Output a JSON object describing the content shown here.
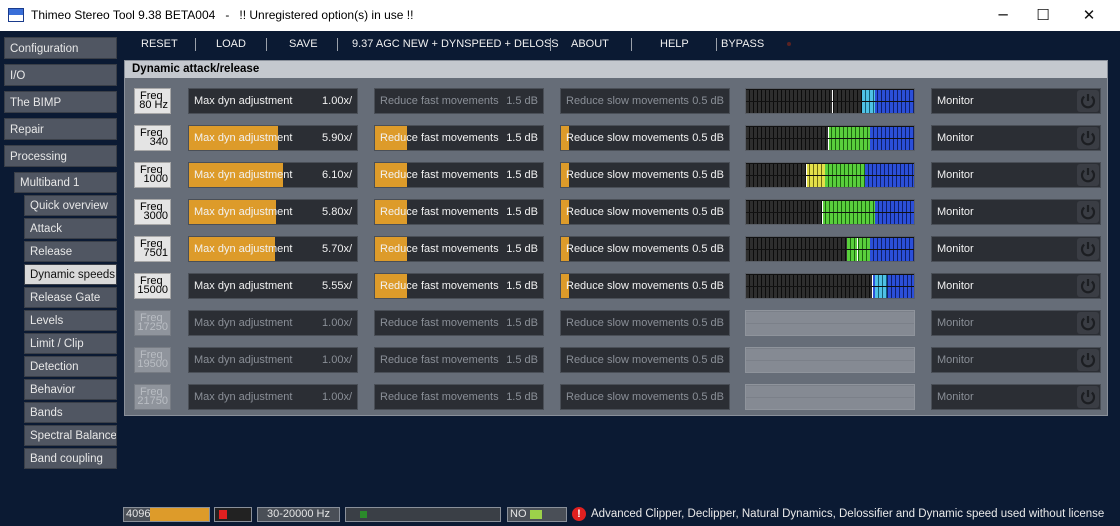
{
  "window": {
    "app_title": "Thimeo Stereo Tool 9.38 BETA004",
    "separator": "-",
    "warning": "!! Unregistered option(s) in use !!",
    "minimize_glyph": "─",
    "maximize_glyph": "☐",
    "close_glyph": "✕"
  },
  "sidebar": {
    "items": [
      {
        "label": "Configuration",
        "level": 0,
        "selected": false
      },
      {
        "label": "I/O",
        "level": 0,
        "selected": false
      },
      {
        "label": "The BIMP",
        "level": 0,
        "selected": false
      },
      {
        "label": "Repair",
        "level": 0,
        "selected": false
      },
      {
        "label": "Processing",
        "level": 0,
        "selected": false
      },
      {
        "label": "Multiband 1",
        "level": 1,
        "selected": false
      },
      {
        "label": "Quick overview",
        "level": 2,
        "selected": false
      },
      {
        "label": "Attack",
        "level": 2,
        "selected": false
      },
      {
        "label": "Release",
        "level": 2,
        "selected": false
      },
      {
        "label": "Dynamic speeds",
        "level": 2,
        "selected": true
      },
      {
        "label": "Release Gate",
        "level": 2,
        "selected": false
      },
      {
        "label": "Levels",
        "level": 2,
        "selected": false
      },
      {
        "label": "Limit / Clip",
        "level": 2,
        "selected": false
      },
      {
        "label": "Detection",
        "level": 2,
        "selected": false
      },
      {
        "label": "Behavior",
        "level": 2,
        "selected": false
      },
      {
        "label": "Bands",
        "level": 2,
        "selected": false
      },
      {
        "label": "Spectral Balance",
        "level": 2,
        "selected": false
      },
      {
        "label": "Band coupling",
        "level": 2,
        "selected": false
      }
    ]
  },
  "toolbar": {
    "reset": "RESET",
    "load": "LOAD",
    "save": "SAVE",
    "preset": "9.37 AGC NEW + DYNSPEED + DELOSS",
    "about": "ABOUT",
    "help": "HELP",
    "bypass": "BYPASS"
  },
  "panel": {
    "title": "Dynamic attack/release",
    "freq_label": "Freq",
    "max_dyn_label": "Max dyn adjustment",
    "fast_label": "Reduce fast movements",
    "slow_label": "Reduce slow movements",
    "monitor_label": "Monitor",
    "bands": [
      {
        "freq": "80 Hz",
        "enabled": true,
        "max_dyn": "1.00x/",
        "max_dyn_fill": 0.0,
        "fast": "1.5 dB",
        "fast_fill": 0.0,
        "slow": "0.5 dB",
        "slow_fill": 0.0,
        "meter": [
          {
            "type": "blue",
            "from": 0.69,
            "to": 1.0
          },
          {
            "type": "cyan",
            "from": 0.69,
            "to": 0.77
          }
        ],
        "meter_peak": 0.51
      },
      {
        "freq": "340",
        "enabled": true,
        "max_dyn": "5.90x/",
        "max_dyn_fill": 0.53,
        "fast": "1.5 dB",
        "fast_fill": 0.19,
        "slow": "0.5 dB",
        "slow_fill": 0.05,
        "meter": [
          {
            "type": "green",
            "from": 0.49,
            "to": 0.74
          },
          {
            "type": "blue",
            "from": 0.74,
            "to": 1.0
          }
        ],
        "meter_peak": 0.49
      },
      {
        "freq": "1000",
        "enabled": true,
        "max_dyn": "6.10x/",
        "max_dyn_fill": 0.56,
        "fast": "1.5 dB",
        "fast_fill": 0.19,
        "slow": "0.5 dB",
        "slow_fill": 0.05,
        "meter": [
          {
            "type": "yellow",
            "from": 0.36,
            "to": 0.47
          },
          {
            "type": "green",
            "from": 0.47,
            "to": 0.71
          },
          {
            "type": "blue",
            "from": 0.71,
            "to": 1.0
          }
        ],
        "meter_peak": 0.36
      },
      {
        "freq": "3000",
        "enabled": true,
        "max_dyn": "5.80x/",
        "max_dyn_fill": 0.52,
        "fast": "1.5 dB",
        "fast_fill": 0.19,
        "slow": "0.5 dB",
        "slow_fill": 0.05,
        "meter": [
          {
            "type": "green",
            "from": 0.45,
            "to": 0.77
          },
          {
            "type": "blue",
            "from": 0.77,
            "to": 1.0
          }
        ],
        "meter_peak": 0.45
      },
      {
        "freq": "7501",
        "enabled": true,
        "max_dyn": "5.70x/",
        "max_dyn_fill": 0.51,
        "fast": "1.5 dB",
        "fast_fill": 0.19,
        "slow": "0.5 dB",
        "slow_fill": 0.05,
        "meter": [
          {
            "type": "green",
            "from": 0.6,
            "to": 0.74
          },
          {
            "type": "blue",
            "from": 0.74,
            "to": 1.0
          }
        ],
        "meter_peak": 0.66
      },
      {
        "freq": "15000",
        "enabled": true,
        "max_dyn": "5.55x/",
        "max_dyn_fill": 0.0,
        "fast": "1.5 dB",
        "fast_fill": 0.19,
        "slow": "0.5 dB",
        "slow_fill": 0.05,
        "meter": [
          {
            "type": "blue",
            "from": 0.75,
            "to": 1.0
          },
          {
            "type": "cyan",
            "from": 0.77,
            "to": 0.84
          }
        ],
        "meter_peak": 0.75
      },
      {
        "freq": "17250",
        "enabled": false,
        "max_dyn": "1.00x/",
        "max_dyn_fill": 0.0,
        "fast": "1.5 dB",
        "fast_fill": 0.0,
        "slow": "0.5 dB",
        "slow_fill": 0.0,
        "meter": [],
        "meter_peak": null
      },
      {
        "freq": "19500",
        "enabled": false,
        "max_dyn": "1.00x/",
        "max_dyn_fill": 0.0,
        "fast": "1.5 dB",
        "fast_fill": 0.0,
        "slow": "0.5 dB",
        "slow_fill": 0.0,
        "meter": [],
        "meter_peak": null
      },
      {
        "freq": "21750",
        "enabled": false,
        "max_dyn": "1.00x/",
        "max_dyn_fill": 0.0,
        "fast": "1.5 dB",
        "fast_fill": 0.0,
        "slow": "0.5 dB",
        "slow_fill": 0.0,
        "meter": [],
        "meter_peak": null
      }
    ]
  },
  "status": {
    "buffer": "4096",
    "buffer_fill": 1.0,
    "range": "30-20000 Hz",
    "no_label": "NO",
    "message": "Advanced Clipper, Declipper, Natural Dynamics, Delossifier and Dynamic speed used without license"
  },
  "colors": {
    "accent_orange": "#dd9b2a",
    "meter_green": "#59cf3c",
    "meter_yellow": "#e4e04a",
    "meter_blue": "#2b4fd8",
    "warning_red": "#e02020"
  }
}
